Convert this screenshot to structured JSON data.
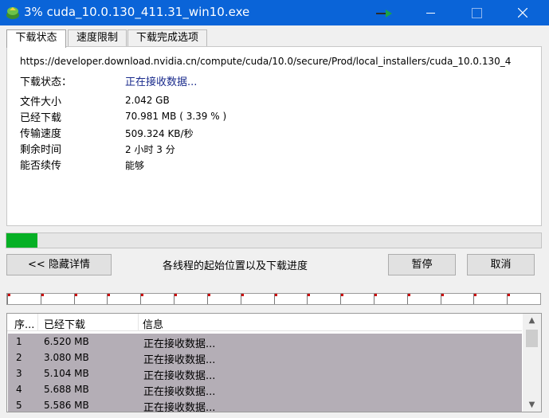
{
  "window": {
    "title": "3% cuda_10.0.130_411.31_win10.exe",
    "accent": "#0a64d8",
    "icons": [
      "app-icon",
      "minimize-icon",
      "maximize-icon",
      "close-icon"
    ]
  },
  "tabs": [
    {
      "label": "下载状态",
      "active": true
    },
    {
      "label": "速度限制",
      "active": false
    },
    {
      "label": "下载完成选项",
      "active": false
    }
  ],
  "info": {
    "url": "https://developer.download.nvidia.cn/compute/cuda/10.0/secure/Prod/local_installers/cuda_10.0.130_4",
    "status_label": "下载状态：",
    "status_value": "正在接收数据...",
    "rows": [
      {
        "label": "文件大小",
        "value": "2.042  GB"
      },
      {
        "label": "已经下载",
        "value": "70.981  MB  ( 3.39 % )"
      },
      {
        "label": "传输速度",
        "value": "509.324  KB/秒"
      },
      {
        "label": "剩余时间",
        "value": "2 小时 3 分"
      },
      {
        "label": "能否续传",
        "value": "能够"
      }
    ]
  },
  "progress": {
    "fraction": 0.0339,
    "color": "#06b025"
  },
  "buttons": {
    "hide": "<< 隐藏详情",
    "pause": "暂停",
    "cancel": "取消"
  },
  "threads_label": "各线程的起始位置以及下载进度",
  "segments": 16,
  "table": {
    "headers": [
      "序...",
      "已经下载",
      "信息"
    ],
    "rows": [
      {
        "id": "1",
        "downloaded": "6.520  MB",
        "info": "正在接收数据..."
      },
      {
        "id": "2",
        "downloaded": "3.080  MB",
        "info": "正在接收数据..."
      },
      {
        "id": "3",
        "downloaded": "5.104  MB",
        "info": "正在接收数据..."
      },
      {
        "id": "4",
        "downloaded": "5.688  MB",
        "info": "正在接收数据..."
      },
      {
        "id": "5",
        "downloaded": "5.586  MB",
        "info": "正在接收数据..."
      }
    ],
    "row_color": "#b4aeb6"
  }
}
